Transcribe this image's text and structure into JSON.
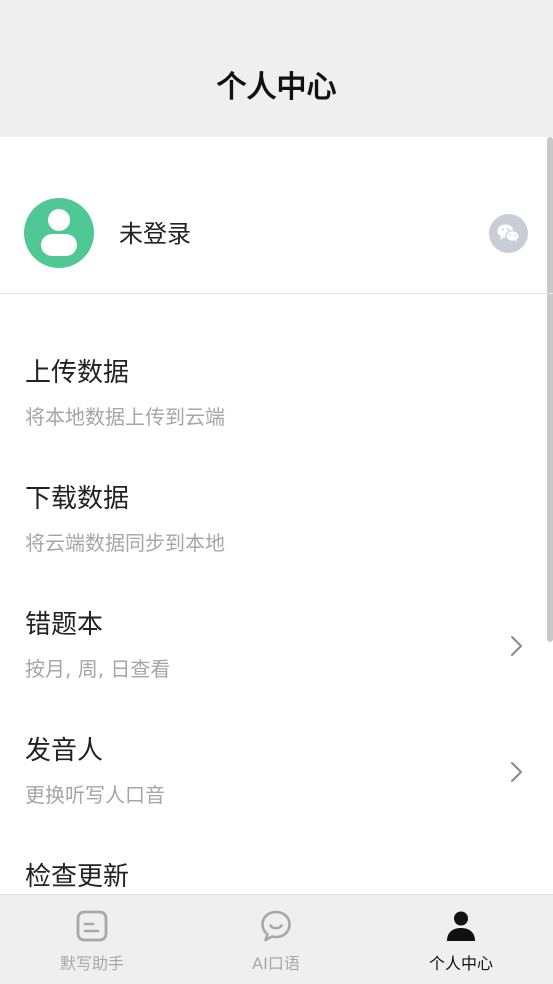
{
  "header": {
    "title": "个人中心"
  },
  "profile": {
    "name": "未登录",
    "login_icon": "wechat-icon",
    "avatar_color": "#4fc895"
  },
  "menu": [
    {
      "title": "上传数据",
      "subtitle": "将本地数据上传到云端",
      "has_arrow": false
    },
    {
      "title": "下载数据",
      "subtitle": "将云端数据同步到本地",
      "has_arrow": false
    },
    {
      "title": "错题本",
      "subtitle": "按月, 周, 日查看",
      "has_arrow": true
    },
    {
      "title": "发音人",
      "subtitle": "更换听写人口音",
      "has_arrow": true
    },
    {
      "title": "检查更新",
      "subtitle": "",
      "has_arrow": false
    }
  ],
  "tabbar": {
    "tabs": [
      {
        "label": "默写助手",
        "icon": "document-icon",
        "active": false
      },
      {
        "label": "AI口语",
        "icon": "chat-bubble-icon",
        "active": false
      },
      {
        "label": "个人中心",
        "icon": "person-icon",
        "active": true
      }
    ]
  }
}
